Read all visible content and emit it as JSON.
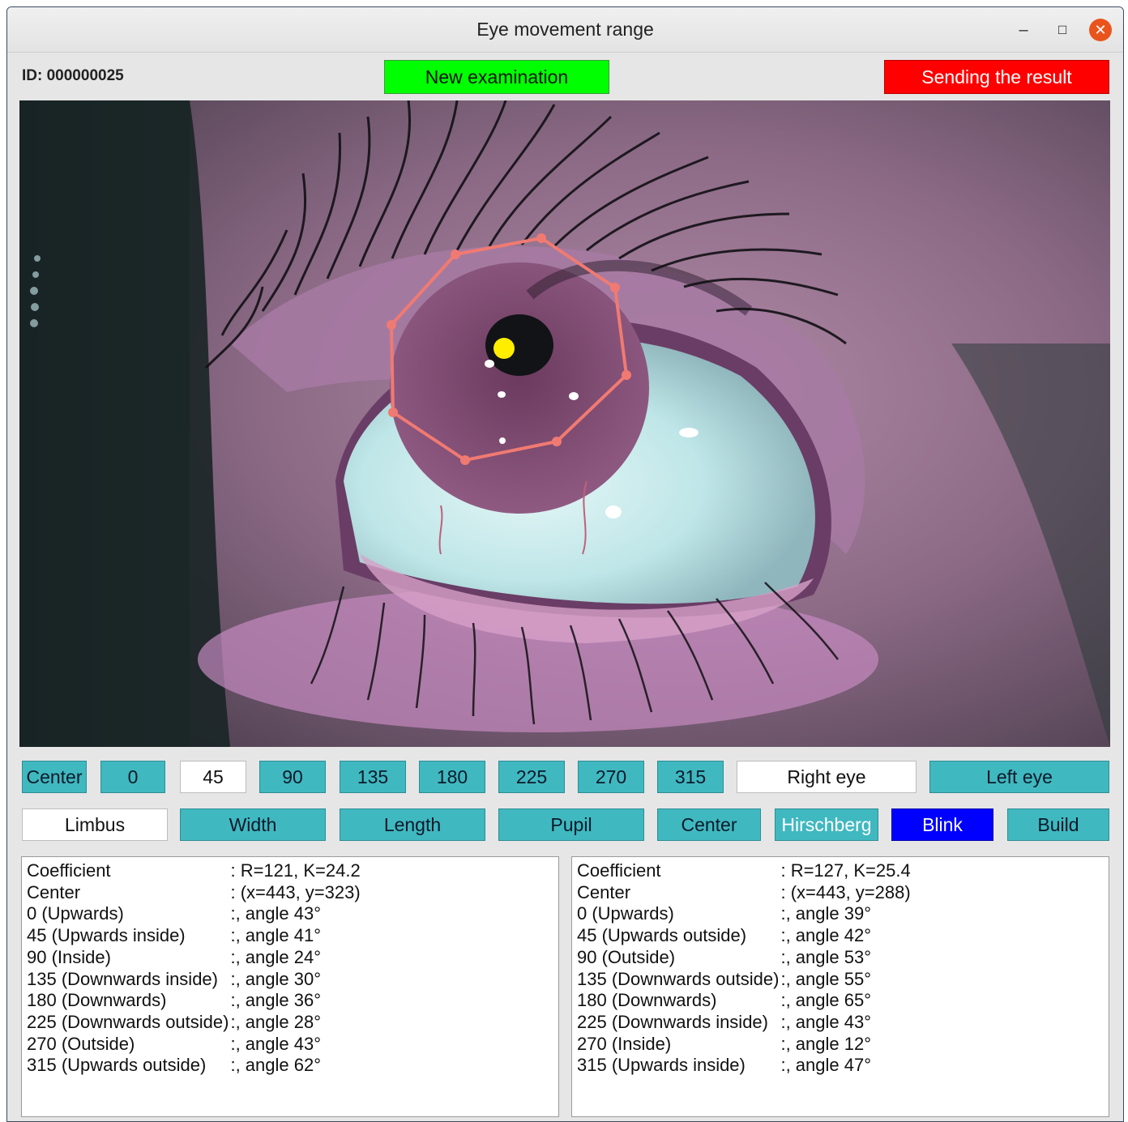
{
  "window": {
    "title": "Eye movement range",
    "controls": {
      "minimize": "–",
      "maximize": "☐",
      "close": "✕"
    }
  },
  "header": {
    "id_label": "ID: 000000025",
    "new_exam_label": "New examination",
    "send_label": "Sending the result",
    "new_exam_color": "#00ff00",
    "send_color": "#ff0000"
  },
  "direction_buttons": [
    {
      "label": "Center",
      "selected": false
    },
    {
      "label": "0",
      "selected": false
    },
    {
      "label": "45",
      "selected": true
    },
    {
      "label": "90",
      "selected": false
    },
    {
      "label": "135",
      "selected": false
    },
    {
      "label": "180",
      "selected": false
    },
    {
      "label": "225",
      "selected": false
    },
    {
      "label": "270",
      "selected": false
    },
    {
      "label": "315",
      "selected": false
    }
  ],
  "eye_buttons": {
    "right": {
      "label": "Right eye",
      "selected": true
    },
    "left": {
      "label": "Left eye",
      "selected": false
    }
  },
  "tool_buttons": [
    {
      "label": "Limbus",
      "style": "white"
    },
    {
      "label": "Width",
      "style": "teal"
    },
    {
      "label": "Length",
      "style": "teal"
    },
    {
      "label": "Pupil",
      "style": "teal"
    },
    {
      "label": "Center",
      "style": "teal"
    },
    {
      "label": "Hirschberg",
      "style": "teal-white-text"
    },
    {
      "label": "Blink",
      "style": "blue"
    },
    {
      "label": "Build",
      "style": "teal"
    }
  ],
  "colors": {
    "teal": "#40b8c0",
    "blink_blue": "#0000ff",
    "limbus_polygon": "#f07a72",
    "pupil_marker": "#ffee00"
  },
  "right_results": [
    {
      "key": "Coefficient",
      "value": ": R=121, K=24.2"
    },
    {
      "key": "Center",
      "value": ": (x=443, y=323)"
    },
    {
      "key": "0 (Upwards)",
      "value": ":, angle 43°"
    },
    {
      "key": "45 (Upwards inside)",
      "value": ":, angle 41°"
    },
    {
      "key": "90 (Inside)",
      "value": ":, angle 24°"
    },
    {
      "key": "135 (Downwards inside)",
      "value": ":, angle 30°"
    },
    {
      "key": "180 (Downwards)",
      "value": ":, angle 36°"
    },
    {
      "key": "225 (Downwards outside)",
      "value": ":, angle 28°"
    },
    {
      "key": "270 (Outside)",
      "value": ":, angle 43°"
    },
    {
      "key": "315 (Upwards outside)",
      "value": ":, angle 62°"
    }
  ],
  "left_results": [
    {
      "key": "Coefficient",
      "value": ": R=127, K=25.4"
    },
    {
      "key": "Center",
      "value": ": (x=443, y=288)"
    },
    {
      "key": "0 (Upwards)",
      "value": ":, angle 39°"
    },
    {
      "key": "45 (Upwards outside)",
      "value": ":, angle 42°"
    },
    {
      "key": "90 (Outside)",
      "value": ":, angle 53°"
    },
    {
      "key": "135 (Downwards outside)",
      "value": ":, angle 55°"
    },
    {
      "key": "180 (Downwards)",
      "value": ":, angle 65°"
    },
    {
      "key": "225 (Downwards inside)",
      "value": ":, angle 43°"
    },
    {
      "key": "270 (Inside)",
      "value": ":, angle 12°"
    },
    {
      "key": "315 (Upwards inside)",
      "value": ":, angle 47°"
    }
  ]
}
